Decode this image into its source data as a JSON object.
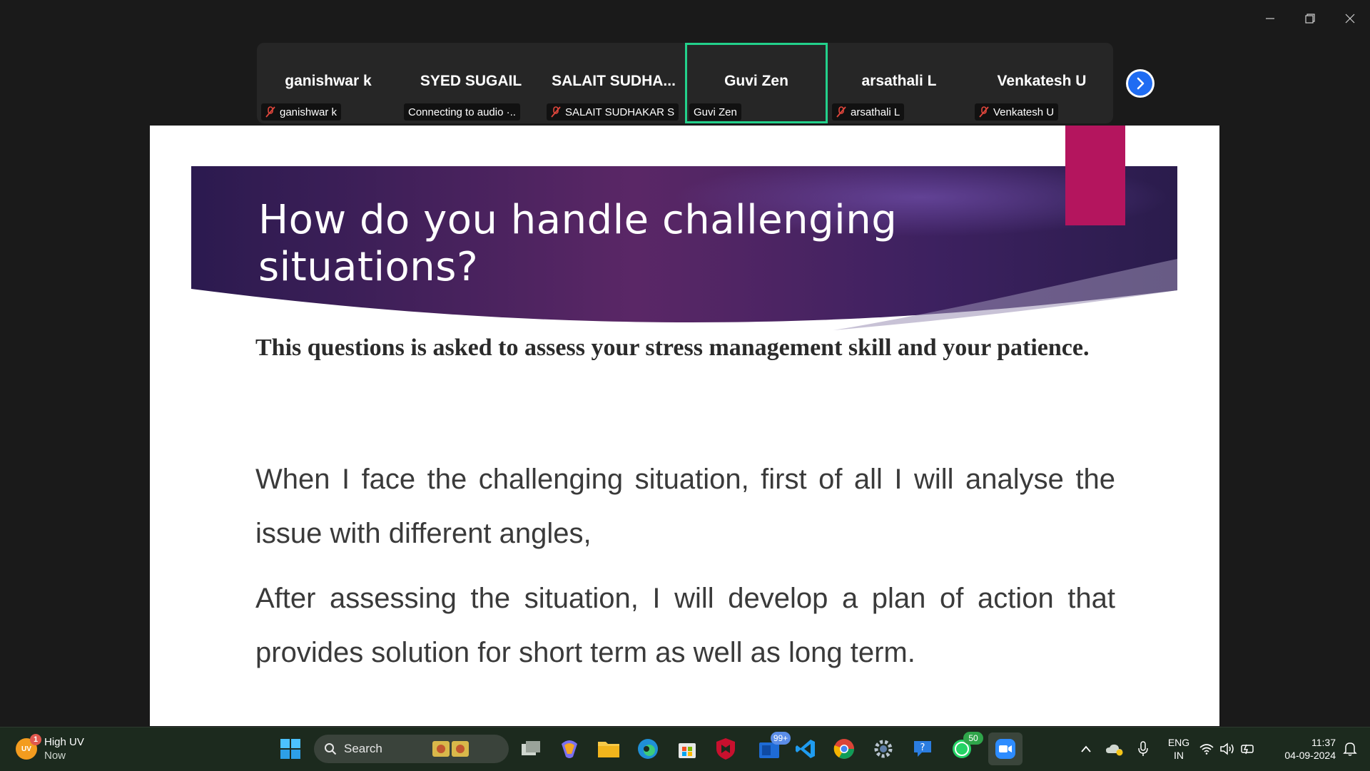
{
  "participants": [
    {
      "name": "ganishwar k",
      "label": "ganishwar k",
      "muted": true
    },
    {
      "name": "SYED SUGAIL",
      "label": "Connecting to audio ·..",
      "muted": false
    },
    {
      "name": "SALAIT  SUDHA...",
      "label": "SALAIT SUDHAKAR S",
      "muted": true
    },
    {
      "name": "Guvi Zen",
      "label": "Guvi Zen",
      "muted": false,
      "active": true
    },
    {
      "name": "arsathali L",
      "label": "arsathali L",
      "muted": true
    },
    {
      "name": "Venkatesh U",
      "label": "Venkatesh U",
      "muted": true
    }
  ],
  "slide": {
    "title": "How do you handle challenging situations?",
    "subtitle": "This questions is asked to assess your stress management skill and your patience.",
    "paragraph_1": "When I face the challenging situation, first of all I will analyse the issue with different angles,",
    "paragraph_2": "After assessing the situation, I will develop a plan of action that provides solution for short term as well as long term."
  },
  "taskbar": {
    "weather_badge": "1",
    "weather_icon_text": "UV",
    "weather_title": "High UV",
    "weather_sub": "Now",
    "search_label": "Search",
    "teams_badge": "99+",
    "whatsapp_badge": "50",
    "lang_line1": "ENG",
    "lang_line2": "IN",
    "time": "11:37",
    "date": "04-09-2024"
  },
  "colors": {
    "active_border": "#23d18b",
    "slide_accent": "#b4155e",
    "banner_dark": "#2a1a4e",
    "banner_mid": "#5a2766",
    "zoom_blue": "#1f6cf2"
  }
}
